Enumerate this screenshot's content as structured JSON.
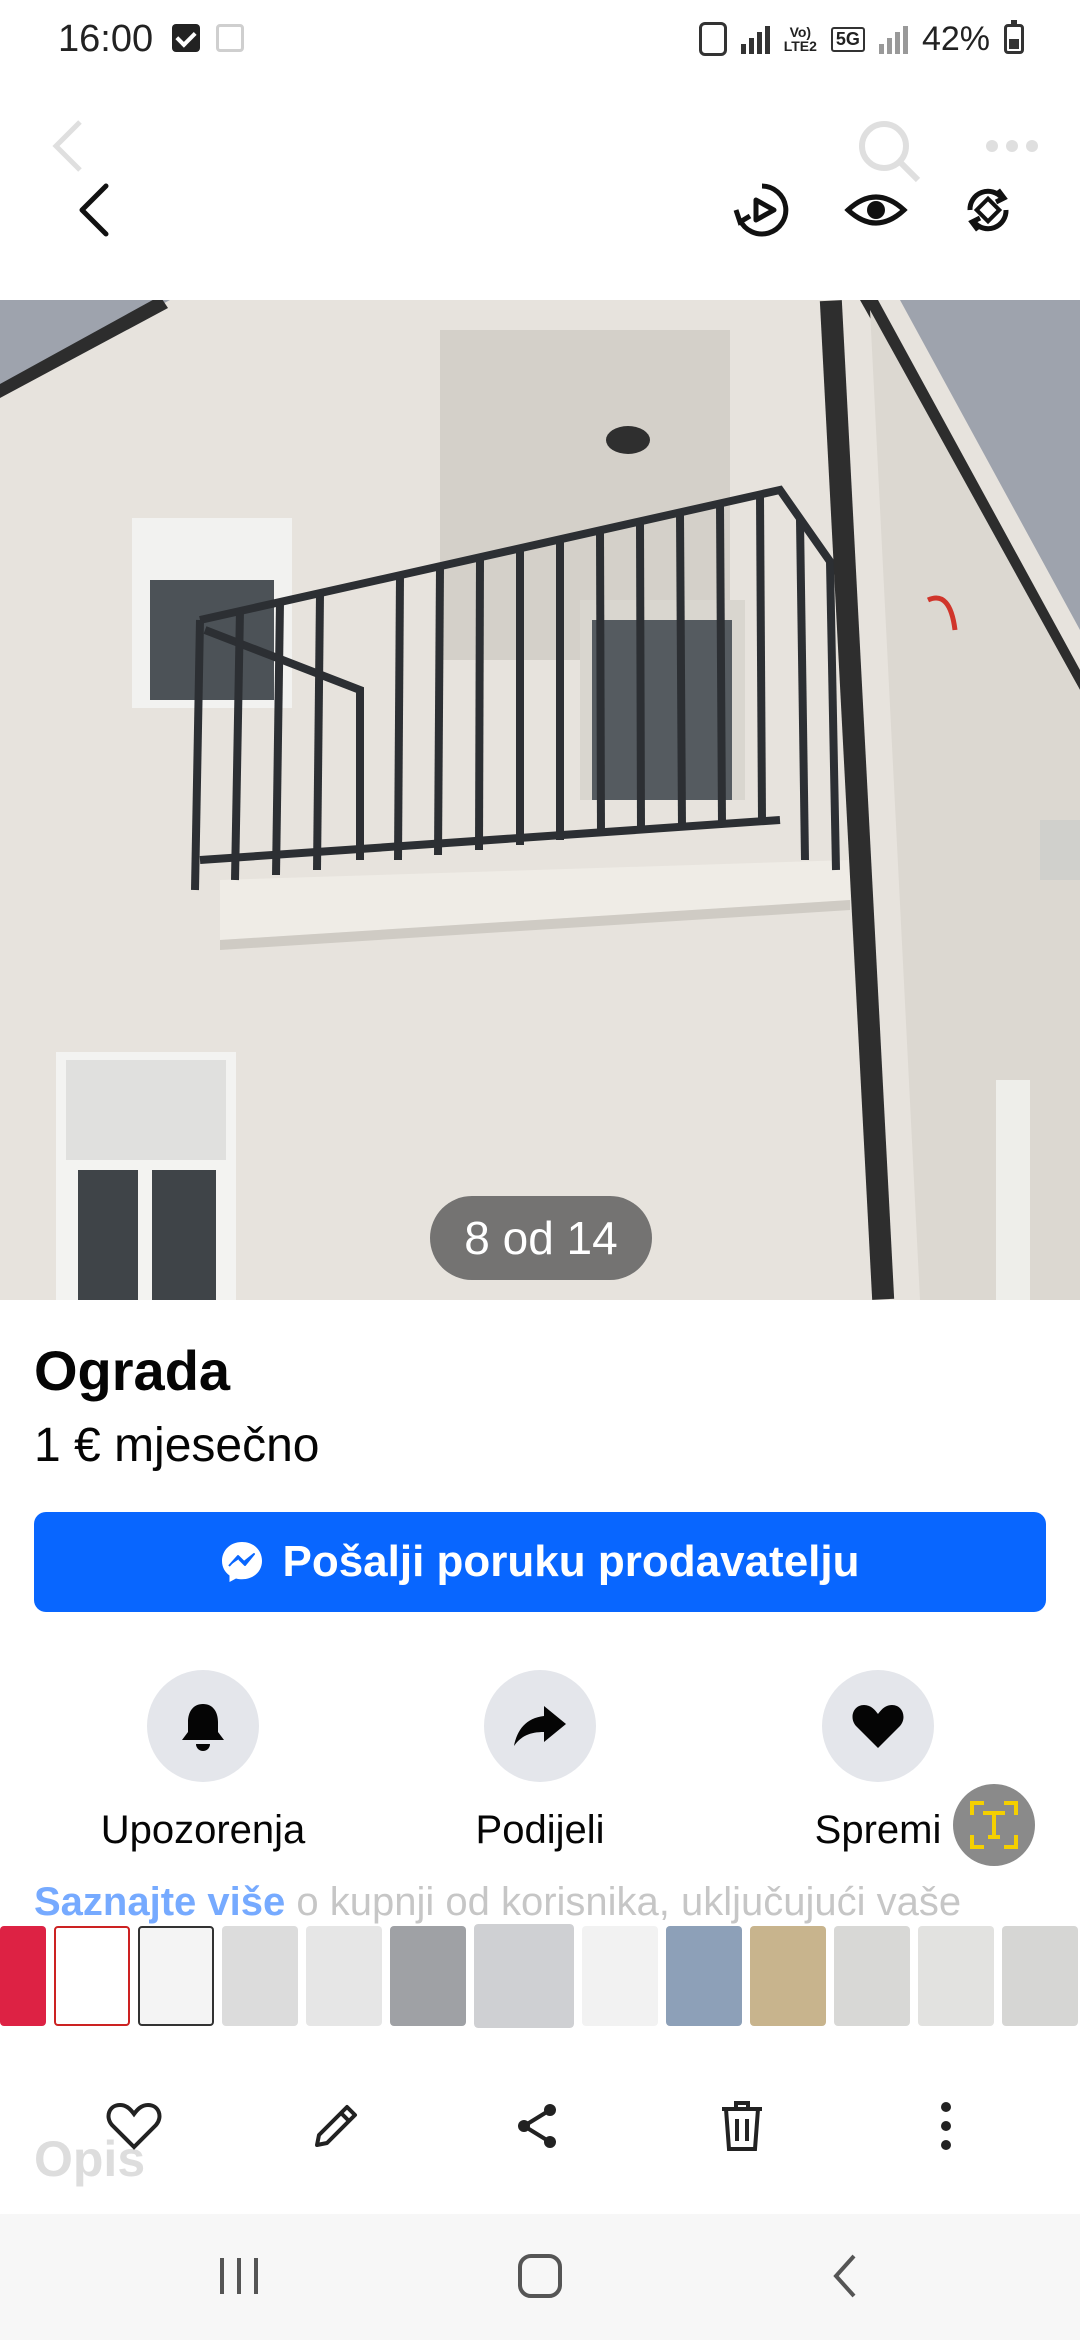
{
  "status": {
    "time": "16:00",
    "network_top": "Vo)",
    "network_bottom": "LTE2",
    "fiveg": "5G",
    "battery": "42%"
  },
  "photo": {
    "counter": "8 od 14"
  },
  "listing": {
    "title": "Ograda",
    "price": "1 € mjesečno",
    "message_button": "Pošalji poruku prodavatelju"
  },
  "actions": {
    "alerts": "Upozorenja",
    "share": "Podijeli",
    "save": "Spremi"
  },
  "peek": {
    "link_text": "Saznajte više",
    "rest_text": " o kupnji od korisnika, uključujući vaše"
  },
  "description_heading": "Opis",
  "thumbnails": {
    "count": 13,
    "active_index": 6
  },
  "icons": {
    "back": "chevron-left-icon",
    "video": "play-rotate-icon",
    "view": "eye-icon",
    "rotate": "rotate-icon",
    "alerts": "bell-icon",
    "share": "share-arrow-icon",
    "save": "heart-icon",
    "messenger": "messenger-icon",
    "text_recognize": "text-scan-icon"
  },
  "colors": {
    "primary": "#0866ff",
    "chip": "#e4e6eb",
    "text": "#050505"
  }
}
